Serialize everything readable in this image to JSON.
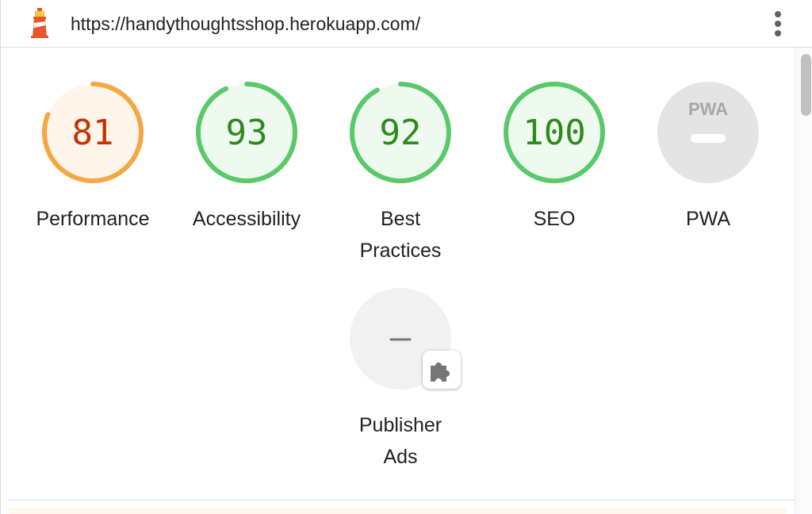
{
  "header": {
    "url": "https://handythoughtsshop.herokuapp.com/",
    "logo_icon": "lighthouse-icon",
    "menu_icon": "kebab-menu-icon"
  },
  "colors": {
    "fail_average": "#f4a742",
    "fail_average_bg": "#fff5eb",
    "average_text": "#c33300",
    "pass": "#59c96a",
    "pass_bg": "#eefaf0",
    "pass_text": "#2f8a1c",
    "na_bg": "#e6e6e6",
    "na_text": "#8a8a8a"
  },
  "categories": [
    {
      "label": "Performance",
      "score": "81",
      "value": 81,
      "rating": "average"
    },
    {
      "label": "Accessibility",
      "score": "93",
      "value": 93,
      "rating": "pass"
    },
    {
      "label": "Best Practices",
      "score": "92",
      "value": 92,
      "rating": "pass"
    },
    {
      "label": "SEO",
      "score": "100",
      "value": 100,
      "rating": "pass"
    },
    {
      "label": "PWA",
      "score": "",
      "value": null,
      "rating": "pwa",
      "badge_text": "PWA",
      "icon": "pwa-badge-icon"
    }
  ],
  "plugin": {
    "label": "Publisher Ads",
    "score": "–",
    "icon": "puzzle-piece-icon"
  }
}
